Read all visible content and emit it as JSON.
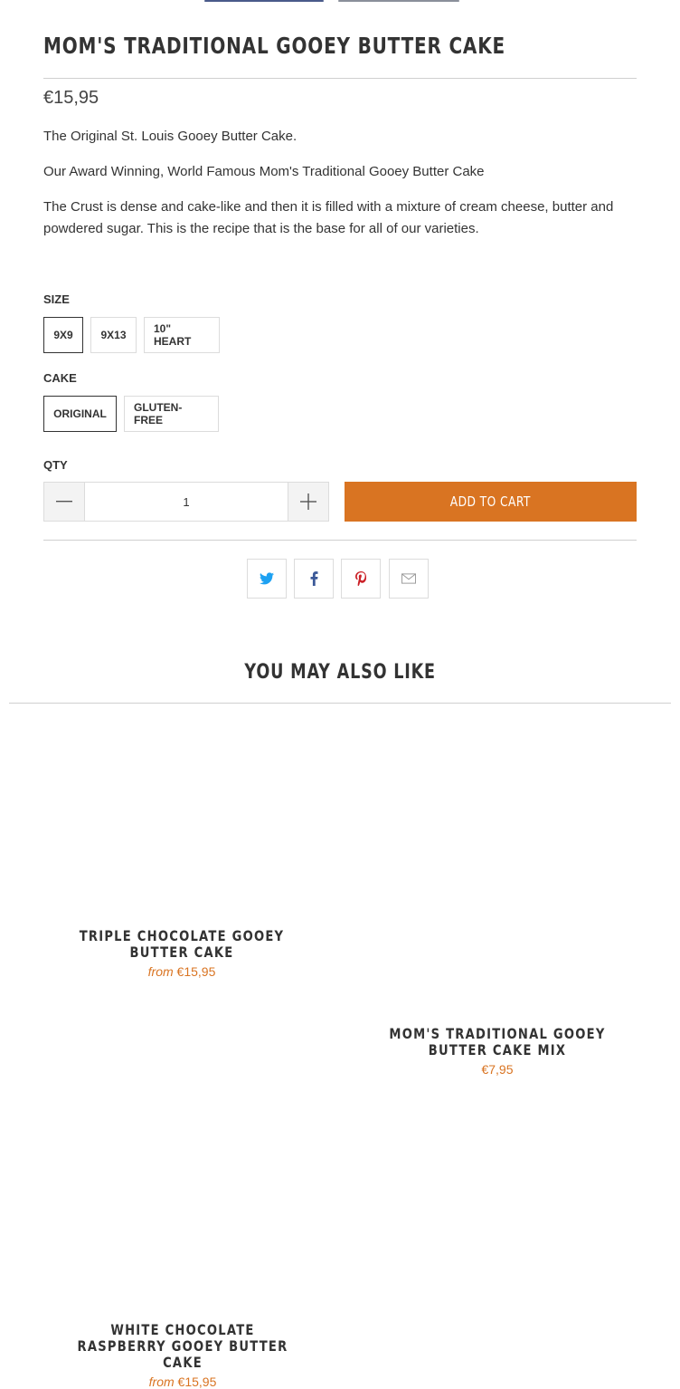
{
  "product": {
    "title": "MOM'S TRADITIONAL GOOEY BUTTER CAKE",
    "price": "€15,95",
    "description": [
      "The Original St. Louis Gooey Butter Cake.",
      "Our Award Winning, World Famous Mom's Traditional Gooey Butter Cake",
      "The Crust is dense and cake-like and then it is filled with a mixture of cream cheese, butter and powdered sugar. This is the recipe that is the base for all of our varieties."
    ]
  },
  "options": {
    "size": {
      "label": "SIZE",
      "values": [
        "9X9",
        "9X13",
        "10\" HEART"
      ],
      "selected": "9X9"
    },
    "cake": {
      "label": "CAKE",
      "values": [
        "ORIGINAL",
        "GLUTEN-FREE"
      ],
      "selected": "ORIGINAL"
    }
  },
  "quantity": {
    "label": "QTY",
    "value": "1"
  },
  "cart": {
    "add_label": "ADD TO CART"
  },
  "share": {
    "icons": [
      "twitter-icon",
      "facebook-icon",
      "pinterest-icon",
      "email-icon"
    ],
    "colors": {
      "twitter": "#1da1f2",
      "facebook": "#3b5998",
      "pinterest": "#cb2027",
      "email": "#999999"
    }
  },
  "related": {
    "title": "YOU MAY ALSO LIKE",
    "items": [
      {
        "name": "TRIPLE CHOCOLATE GOOEY BUTTER CAKE",
        "price_prefix": "from",
        "price": "€15,95"
      },
      {
        "name": "MOM'S TRADITIONAL GOOEY BUTTER CAKE MIX",
        "price_prefix": "",
        "price": "€7,95"
      },
      {
        "name": "WHITE CHOCOLATE RASPBERRY GOOEY BUTTER CAKE",
        "price_prefix": "from",
        "price": "€15,95"
      }
    ]
  },
  "colors": {
    "accent": "#d97422",
    "text": "#333333",
    "border": "#dcdcdc"
  }
}
